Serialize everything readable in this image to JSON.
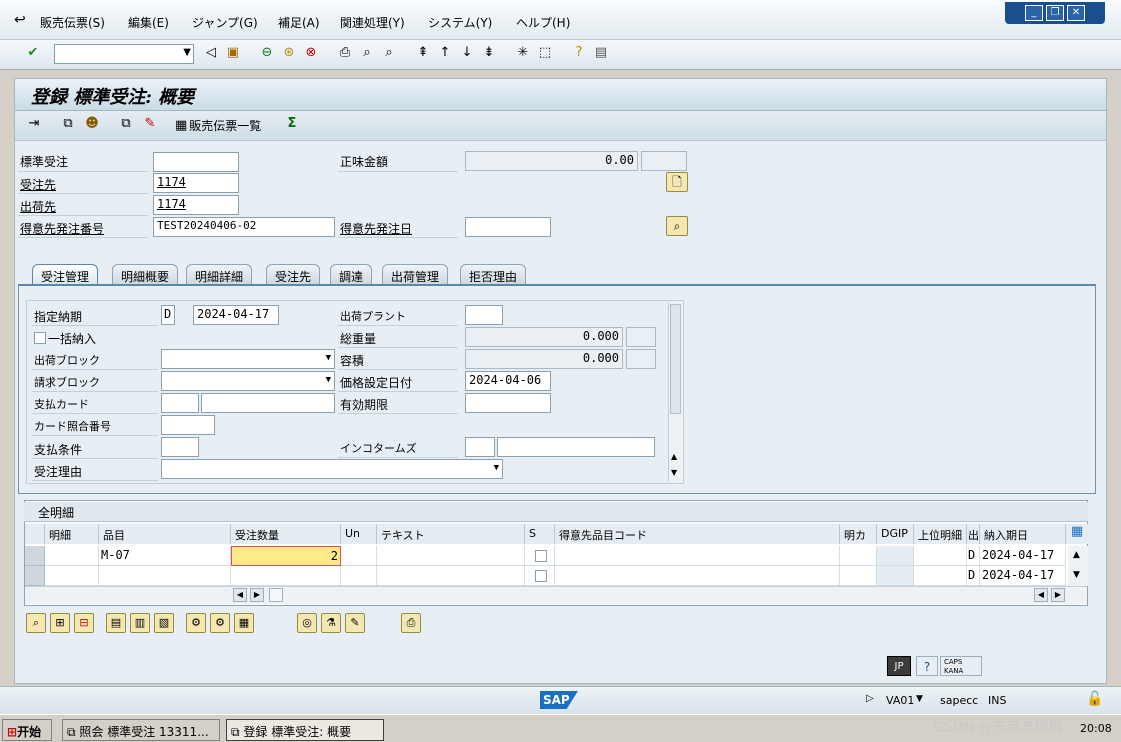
{
  "menu": [
    "販売伝票(S)",
    "編集(E)",
    "ジャンプ(G)",
    "補足(A)",
    "関連処理(Y)",
    "システム(Y)",
    "ヘルプ(H)"
  ],
  "title": "登録 標準受注: 概要",
  "toolbar": {
    "order_list_label": "販売伝票一覧"
  },
  "header": {
    "order_type_label": "標準受注",
    "order_type_value": "",
    "net_value_label": "正味金額",
    "net_value_value": "0.00",
    "sold_to_label": "受注先",
    "sold_to_value": "1174",
    "ship_to_label": "出荷先",
    "ship_to_value": "1174",
    "po_number_label": "得意先発注番号",
    "po_number_value": "TEST20240406-02",
    "po_date_label": "得意先発注日",
    "po_date_value": ""
  },
  "tabs": [
    "受注管理",
    "明細概要",
    "明細詳細",
    "受注先",
    "調達",
    "出荷管理",
    "拒否理由"
  ],
  "sales_panel": {
    "req_deliv_date_label": "指定納期",
    "req_deliv_date_type": "D",
    "req_deliv_date_value": "2024-04-17",
    "deliver_plant_label": "出荷プラント",
    "complete_dlv_label": "一括納入",
    "total_weight_label": "総重量",
    "total_weight_value": "0.000",
    "delivery_block_label": "出荷ブロック",
    "volume_label": "容積",
    "volume_value": "0.000",
    "billing_block_label": "請求ブロック",
    "pricing_date_label": "価格設定日付",
    "pricing_date_value": "2024-04-06",
    "payment_card_label": "支払カード",
    "valid_to_label": "有効期限",
    "card_verif_label": "カード照合番号",
    "payment_terms_label": "支払条件",
    "incoterms_label": "インコタームズ",
    "order_reason_label": "受注理由"
  },
  "items_table": {
    "title": "全明細",
    "columns": [
      "明細",
      "品目",
      "受注数量",
      "Un",
      "テキスト",
      "S",
      "得意先品目コード",
      "明カ",
      "DGIP",
      "上位明細",
      "出",
      "納入期日"
    ],
    "rows": [
      {
        "item": "",
        "material": "M-07",
        "qty": "2",
        "un": "",
        "text": "",
        "cust_mat": "",
        "cat": "",
        "dgip": "",
        "higher": "",
        "d": "D",
        "date": "2024-04-17"
      },
      {
        "item": "",
        "material": "",
        "qty": "",
        "un": "",
        "text": "",
        "cust_mat": "",
        "cat": "",
        "dgip": "",
        "higher": "",
        "d": "D",
        "date": "2024-04-17"
      }
    ]
  },
  "status": {
    "transaction": "VA01",
    "system": "sapecc",
    "mode": "INS",
    "lang": "JP",
    "caps": "CAPS",
    "kana": "KANA"
  },
  "taskbar": {
    "start": "开始",
    "task1": "照会 標準受注 13311...",
    "task2": "登録 標準受注: 概要",
    "watermark": "CSDN @东京老树根",
    "clock": "20:08"
  },
  "colors": {
    "accent": "#5c88a8",
    "highlight": "#ffe98a",
    "sap_blue": "#1a6fc4"
  }
}
